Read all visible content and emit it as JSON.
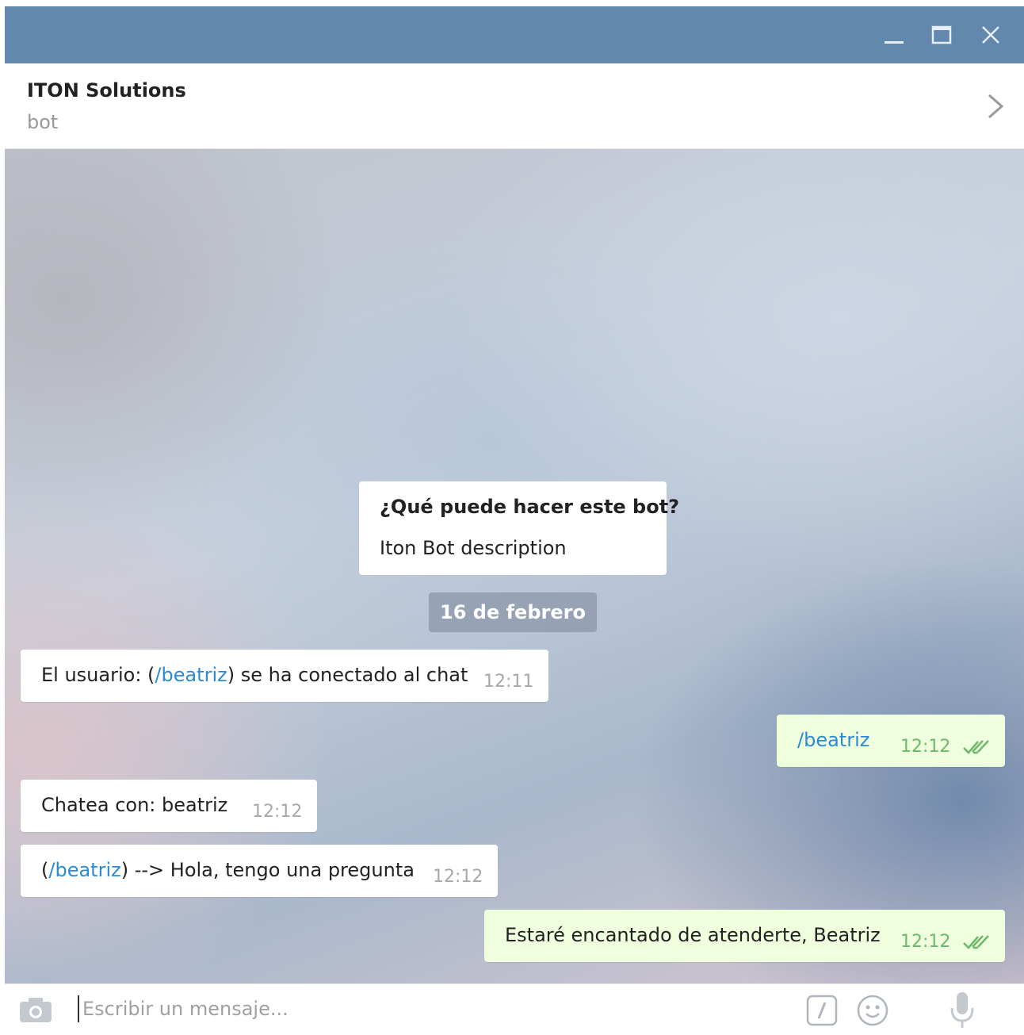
{
  "header": {
    "title": "ITON Solutions",
    "subtitle": "bot"
  },
  "info_card": {
    "title": "¿Qué puede hacer este bot?",
    "description": "Iton Bot description"
  },
  "date_separator": "16 de febrero",
  "messages": [
    {
      "direction": "in",
      "text_before": "El usuario: (",
      "link": "/beatriz",
      "text_after": ") se ha conectado al chat",
      "time": "12:11"
    },
    {
      "direction": "out",
      "link": "/beatriz",
      "time": "12:12",
      "status": "read"
    },
    {
      "direction": "in",
      "text": "Chatea con: beatriz",
      "time": "12:12"
    },
    {
      "direction": "in",
      "text_before": "(",
      "link": "/beatriz",
      "text_after": ") --> Hola, tengo una pregunta",
      "time": "12:12"
    },
    {
      "direction": "out",
      "text": "Estaré encantado de atenderte, Beatriz",
      "time": "12:12",
      "status": "read"
    }
  ],
  "composer": {
    "placeholder": "Escribir un mensaje..."
  },
  "colors": {
    "titlebar": "#6289ad",
    "outgoing_bubble": "#efffde",
    "link": "#2b8ad3",
    "read_check": "#6fb76b"
  },
  "icons": [
    "minimize-icon",
    "maximize-icon",
    "close-icon",
    "chevron-right-icon",
    "double-check-icon",
    "camera-icon",
    "bot-command-icon",
    "emoji-icon",
    "microphone-icon"
  ]
}
